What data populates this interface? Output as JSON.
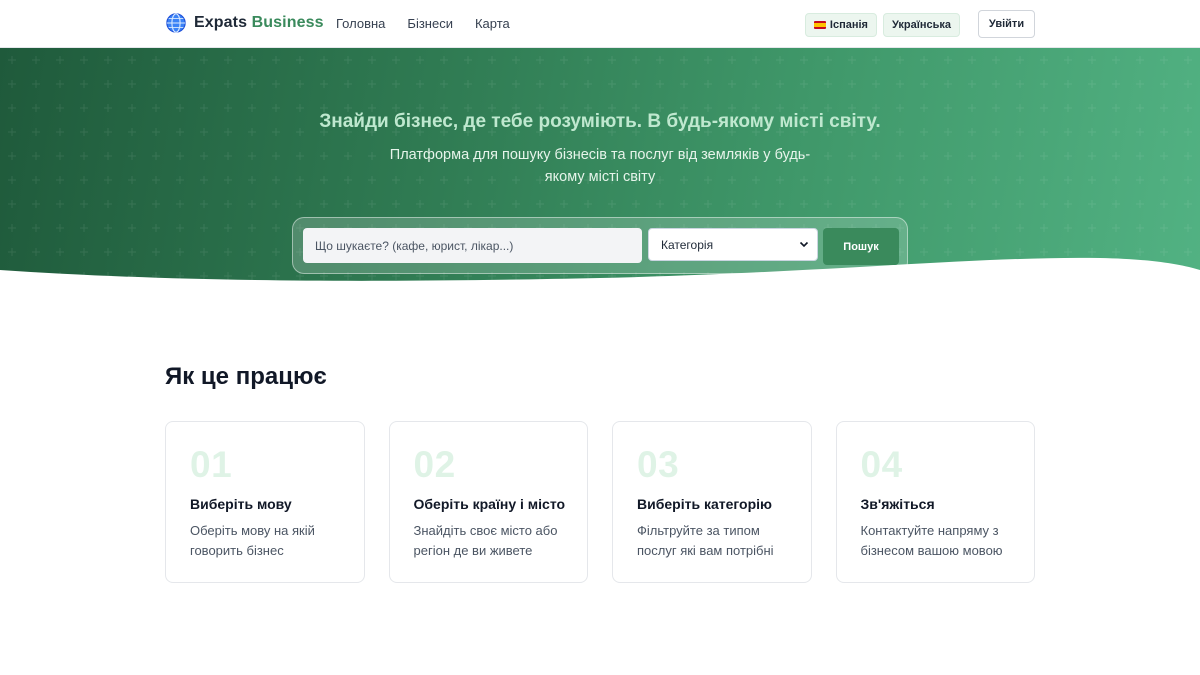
{
  "header": {
    "logo_text": "Expats",
    "logo_accent": "Business",
    "logo_icon": "globe-icon",
    "nav": [
      {
        "label": "Головна"
      },
      {
        "label": "Бізнеси"
      },
      {
        "label": "Карта"
      }
    ],
    "country_label": "Іспанія",
    "country_icon": "spain-flag-icon",
    "language_label": "Українська",
    "login_label": "Увійти"
  },
  "hero": {
    "title": "Знайди бізнес, де тебе розуміють. В будь-якому місті світу.",
    "subtitle": "Платформа для пошуку бізнесів та послуг від земляків у будь-якому місті світу",
    "search_placeholder": "Що шукаєте? (кафе, юрист, лікар...)",
    "category_value": "Категорія",
    "search_button": "Пошук"
  },
  "how_it_works": {
    "title": "Як це працює",
    "steps": [
      {
        "number": "01",
        "title": "Виберіть мову",
        "description": "Оберіть мову на якій говорить бізнес"
      },
      {
        "number": "02",
        "title": "Оберіть країну і місто",
        "description": "Знайдіть своє місто або регіон де ви живете"
      },
      {
        "number": "03",
        "title": "Виберіть категорію",
        "description": "Фільтруйте за типом послуг які вам потрібні"
      },
      {
        "number": "04",
        "title": "Зв'яжіться",
        "description": "Контактуйте напряму з бізнесом вашою мовою"
      }
    ]
  },
  "colors": {
    "brand_green": "#3a8a5c",
    "hero_dark": "#1f5a3b",
    "hero_light": "#52b283",
    "step_number": "#dff3e6"
  }
}
